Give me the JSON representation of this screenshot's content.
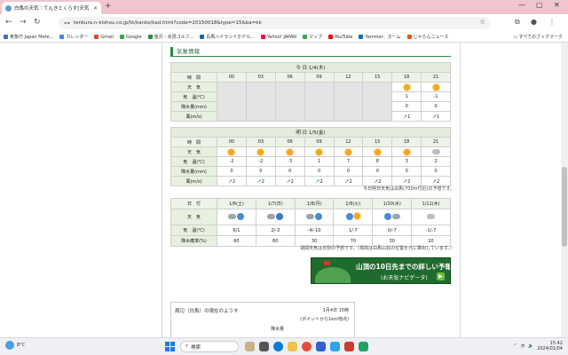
{
  "browser": {
    "tab_title": "白馬の天気｜てんきとくらす[天気",
    "url": "tenkura.n-kishou.co.jp/tk/kanko/kad.html?code=20150018&type=15&ba=kk",
    "bookmarks": [
      "気象庁 Japan Mete...",
      "カレンダー",
      "Gmail",
      "Google",
      "金沢・氷見ゴルフ...",
      "白馬ハイランドホテル...",
      "Yahoo! JAPAN",
      "マップ",
      "YouTube",
      "Yammer：ホーム",
      "じゃらんニュース"
    ],
    "all_bookmarks": "すべてのブックマーク"
  },
  "page": {
    "section_title": "気象情報",
    "today": {
      "caption": "今 日 1/4(木)",
      "labels": [
        "時　間",
        "天　気",
        "気　温(℃)",
        "降水量(mm)",
        "風(m/s)"
      ],
      "hours": [
        "00",
        "03",
        "06",
        "09",
        "12",
        "15",
        "18",
        "21"
      ],
      "temps": [
        "",
        "",
        "",
        "",
        "",
        "",
        "1",
        "-1"
      ],
      "precip": [
        "",
        "",
        "",
        "",
        "",
        "",
        "0",
        "0"
      ],
      "wind": [
        "",
        "",
        "",
        "",
        "",
        "",
        "1",
        "1"
      ]
    },
    "tomorrow": {
      "caption": "明 日 1/5(金)",
      "hours": [
        "00",
        "03",
        "06",
        "09",
        "12",
        "15",
        "18",
        "21"
      ],
      "temps": [
        "-2",
        "-2",
        "-3",
        "1",
        "7",
        "8",
        "3",
        "2"
      ],
      "precip": [
        "0",
        "0",
        "0",
        "0",
        "0",
        "0",
        "0",
        "0"
      ],
      "wind": [
        "2",
        "2",
        "2",
        "2",
        "2",
        "2",
        "2",
        "2"
      ]
    },
    "note1": "今日明日天気は白馬(700m付近)の予想です。",
    "weekly": {
      "labels": [
        "日　付",
        "天　気",
        "気　温(℃)",
        "降水確率(%)"
      ],
      "dates": [
        "1/6(土)",
        "1/7(日)",
        "1/8(月)",
        "1/9(火)",
        "1/10(水)",
        "1/11(木)"
      ],
      "temps": [
        "6/1",
        "2/-3",
        "-4/-10",
        "1/-7",
        "0/-7",
        "-1/-7"
      ],
      "pop": [
        "60",
        "80",
        "30",
        "70",
        "30",
        "20"
      ]
    },
    "note2": "週間天気は日別の予想です。（標高は白馬山荘の位置を元に算出しています。）",
    "banner": {
      "line1": "山頂の10日先までの詳しい予報",
      "line2": "(お天気ナビゲータ)"
    },
    "obs": {
      "title": "周辺（白馬）の現在のようす",
      "date": "1月4日 15時",
      "point": "(ポイントから1km地点)",
      "col": "降水量"
    }
  },
  "taskbar": {
    "weather": "8°C",
    "search_placeholder": "検索",
    "time": "15:42",
    "date": "2024/01/04"
  }
}
